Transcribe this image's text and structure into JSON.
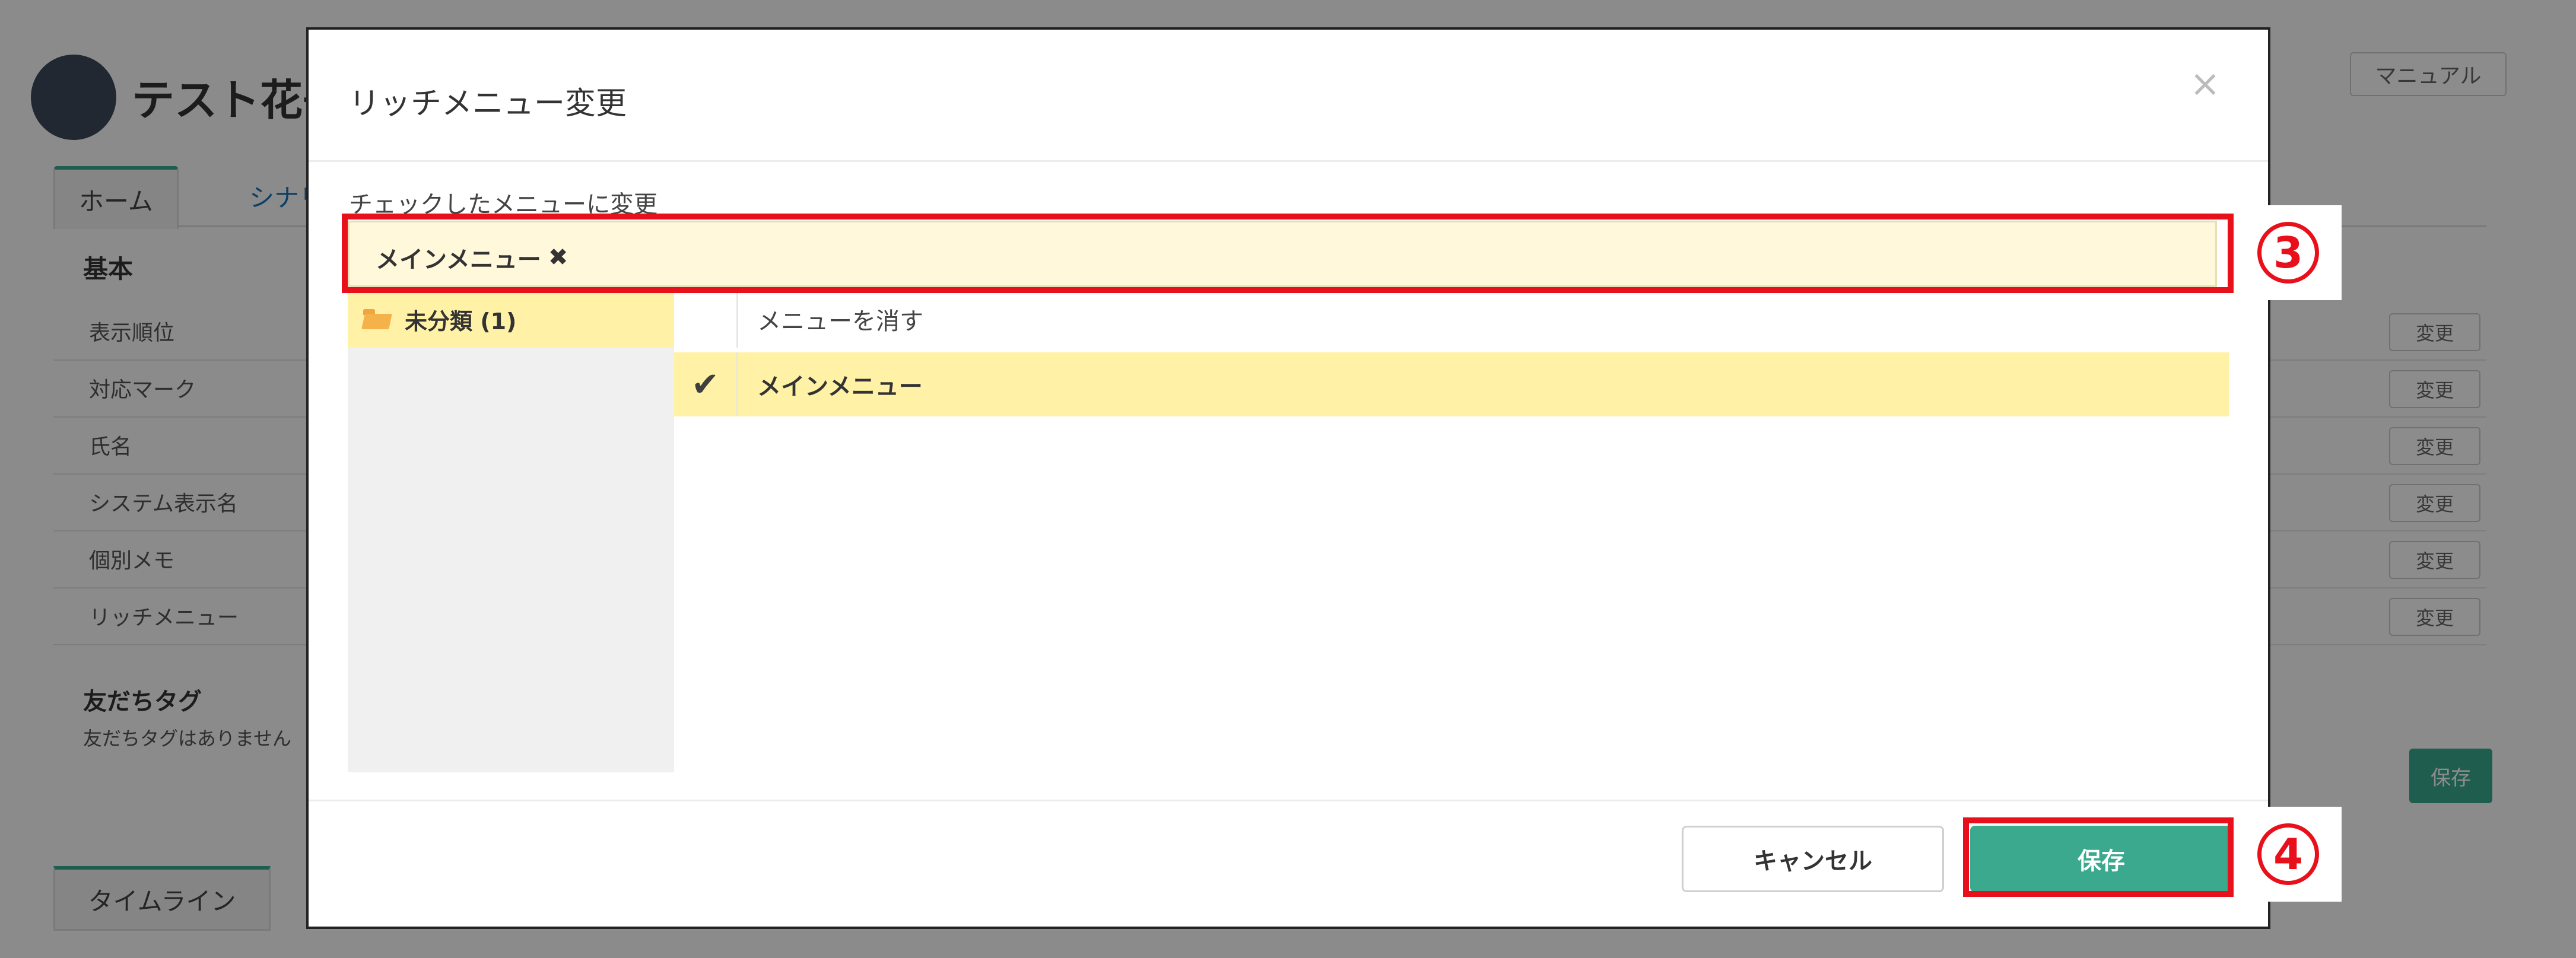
{
  "background": {
    "title": "テスト花子",
    "manual_label": "マニュアル",
    "tabs": [
      "ホーム",
      "シナリオ"
    ],
    "section_title": "基本",
    "rows": [
      {
        "label": "表示順位",
        "action": "変更"
      },
      {
        "label": "対応マーク",
        "action": "変更"
      },
      {
        "label": "氏名",
        "action": "変更"
      },
      {
        "label": "システム表示名",
        "action": "変更"
      },
      {
        "label": "個別メモ",
        "action": "変更"
      },
      {
        "label": "リッチメニュー",
        "action": "変更"
      }
    ],
    "tags_title": "友だちタグ",
    "tags_note": "友だちタグはありません",
    "save_label": "保存",
    "timeline_label": "タイムライン"
  },
  "modal": {
    "title": "リッチメニュー変更",
    "close_glyph": "×",
    "menu_label": "チェックしたメニューに変更",
    "selected_tag": "メインメニュー",
    "remove_glyph": "✖",
    "category": "未分類 (1)",
    "options": [
      {
        "label": "メニューを消す",
        "checked": false
      },
      {
        "label": "メインメニュー",
        "checked": true
      }
    ],
    "check_glyph": "✔",
    "cancel_label": "キャンセル",
    "save_label": "保存"
  },
  "annotations": {
    "step3": "3",
    "step4": "4",
    "color": "#e8101a"
  },
  "colors": {
    "accent": "#3aa98e",
    "highlight": "#fff1a6",
    "selected_bg": "#fff8db"
  }
}
